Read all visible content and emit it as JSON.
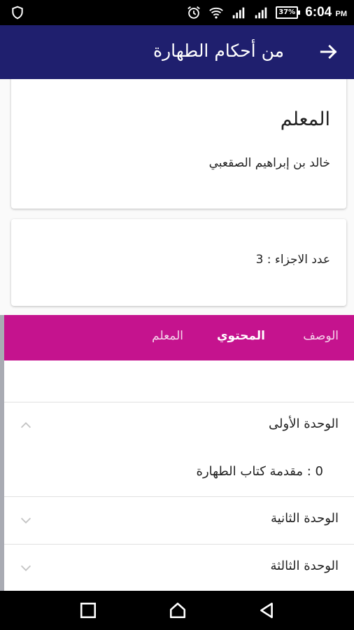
{
  "status_bar": {
    "time": "6:04",
    "ampm": "PM",
    "battery": "37%",
    "icons": [
      "shield-icon",
      "alarm-icon",
      "wifi-icon",
      "signal-icon",
      "signal-icon",
      "battery-icon"
    ]
  },
  "app_bar": {
    "title": "من أحكام الطهارة",
    "back_icon": "arrow-right-icon"
  },
  "teacher_card": {
    "heading": "المعلم",
    "name": "خالد بن إبراهيم الصقعبي"
  },
  "parts_card": {
    "text": "عدد الاجزاء : 3"
  },
  "tabs": [
    {
      "label": "الوصف",
      "active": false
    },
    {
      "label": "المحتوي",
      "active": true
    },
    {
      "label": "المعلم",
      "active": false
    }
  ],
  "units": [
    {
      "title": "الوحدة الأولى",
      "expanded": true,
      "lessons": [
        "0 : مقدمة كتاب الطهارة"
      ]
    },
    {
      "title": "الوحدة الثانية",
      "expanded": false
    },
    {
      "title": "الوحدة الثالثة",
      "expanded": false
    }
  ],
  "colors": {
    "app_bar": "#1f1f6e",
    "tabs": "#c5138e",
    "status_bar": "#000000"
  }
}
